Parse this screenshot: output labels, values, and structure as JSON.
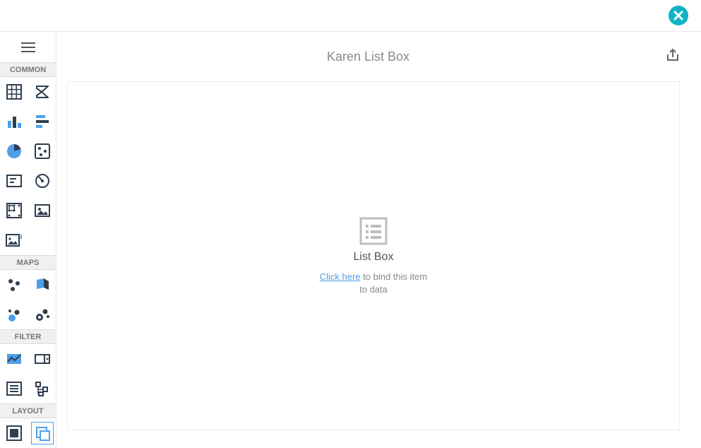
{
  "color": {
    "accent": "#4e9fe8",
    "close": "#0eb4c5",
    "dark": "#2d3e50",
    "grey": "#8a8a8a"
  },
  "pageTitle": "Karen List Box",
  "sidebar": {
    "sections": {
      "common": "COMMON",
      "maps": "MAPS",
      "filter": "FILTER",
      "layout": "LAYOUT"
    }
  },
  "placeholder": {
    "label": "List Box",
    "link": "Click here",
    "rest": " to bind this item to data"
  },
  "icons": {
    "close": "close-icon",
    "export": "export-icon",
    "menu": "menu-icon",
    "grid": "grid-icon",
    "sigma": "sigma-icon",
    "bar": "bar-chart-icon",
    "hbar": "horizontal-bar-icon",
    "pie": "pie-chart-icon",
    "dice": "dice-icon",
    "card": "card-icon",
    "gauge": "gauge-icon",
    "treemap": "treemap-icon",
    "image": "image-icon",
    "webimg": "web-image-icon",
    "dots": "scatter-icon",
    "poly": "polygon-icon",
    "bubble": "bubble-map-icon",
    "pointmap": "point-map-icon",
    "range": "range-filter-icon",
    "combo": "combo-filter-icon",
    "list": "list-filter-icon",
    "tree": "tree-filter-icon",
    "group": "group-layout-icon",
    "tab": "tab-layout-icon"
  }
}
